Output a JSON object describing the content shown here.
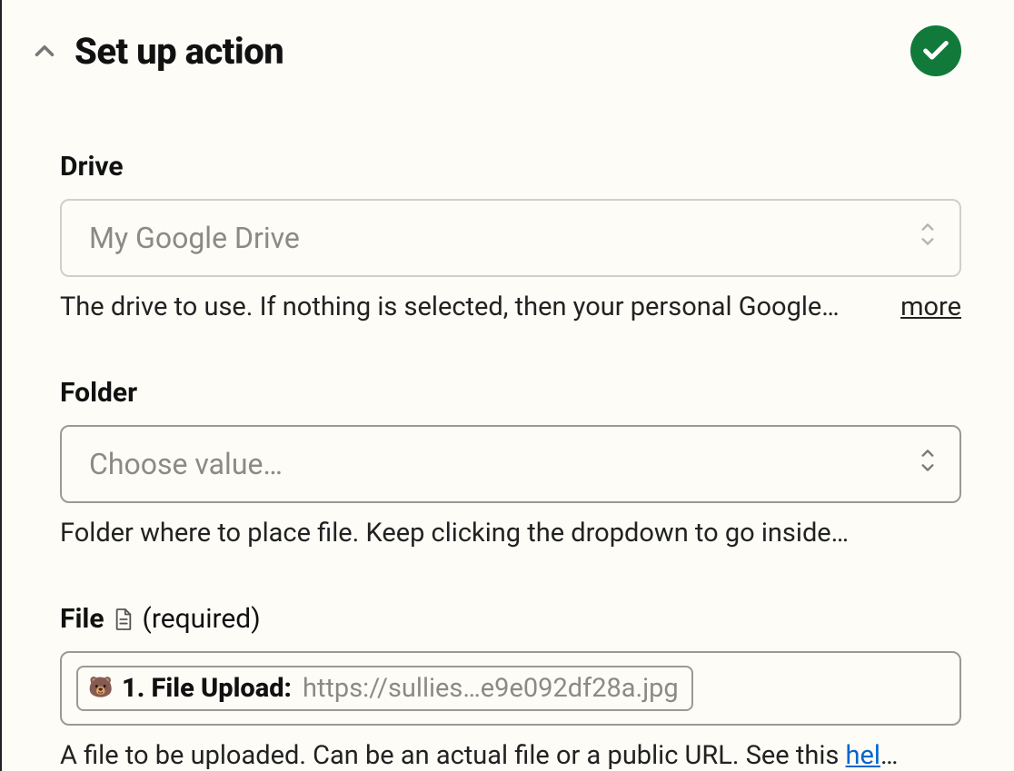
{
  "section": {
    "title": "Set up action"
  },
  "fields": {
    "drive": {
      "label": "Drive",
      "placeholder": "My Google Drive",
      "helper": "The drive to use. If nothing is selected, then your personal Google…",
      "more": "more"
    },
    "folder": {
      "label": "Folder",
      "placeholder": "Choose value…",
      "helper": "Folder where to place file. Keep clicking the dropdown to go inside…"
    },
    "file": {
      "label": "File",
      "required_text": "(required)",
      "pill_icon": "🐻",
      "pill_label": "1. File Upload:",
      "pill_value": "https://sullies…e9e092df28a.jpg",
      "helper_prefix": "A file to be uploaded. Can be an actual file or a public URL. See this ",
      "helper_link": "hel",
      "helper_suffix": "…"
    }
  }
}
